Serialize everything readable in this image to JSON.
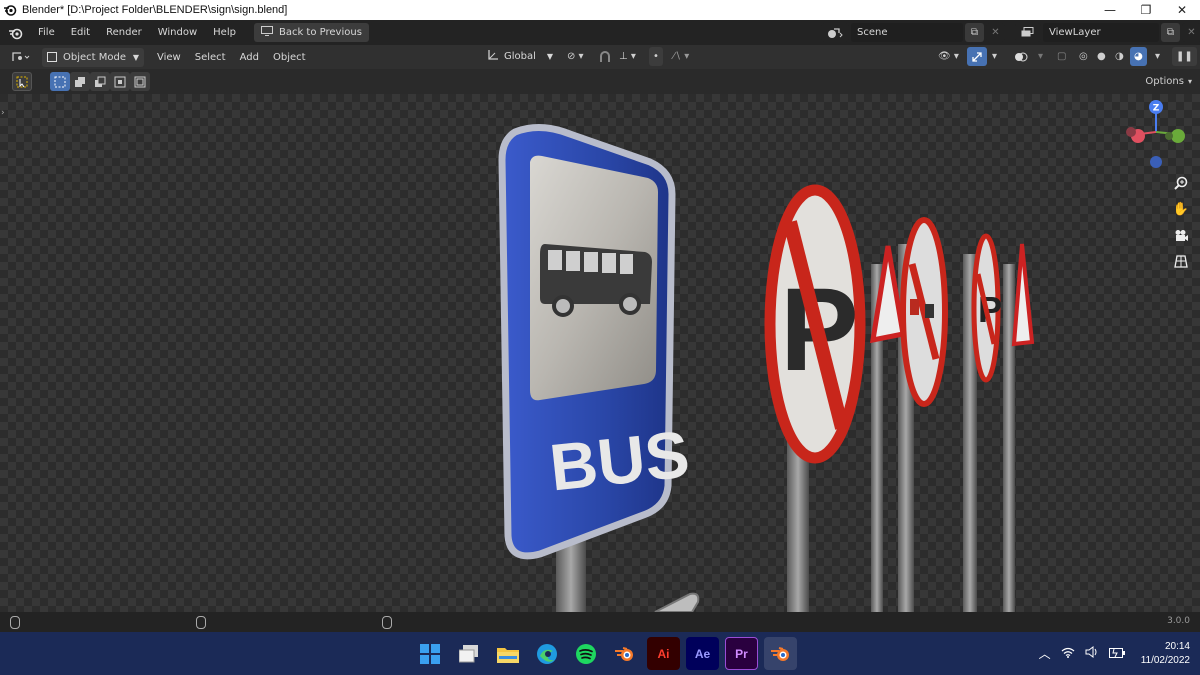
{
  "window": {
    "title": "Blender* [D:\\Project Folder\\BLENDER\\sign\\sign.blend]",
    "controls": [
      "—",
      "❐",
      "✕"
    ]
  },
  "topbar": {
    "menus": [
      "File",
      "Edit",
      "Render",
      "Window",
      "Help"
    ],
    "back_button": "Back to Previous",
    "scene_name": "Scene",
    "view_layer": "ViewLayer"
  },
  "header": {
    "mode": "Object Mode",
    "menus": [
      "View",
      "Select",
      "Add",
      "Object"
    ],
    "transform_orientation": "Global"
  },
  "toolbar": {
    "options_label": "Options"
  },
  "viewport": {
    "sign_text": "BUS",
    "gizmo_axis": "Z"
  },
  "statusbar": {
    "version": "3.0.0"
  },
  "taskbar": {
    "apps": [
      {
        "name": "windows-start",
        "label": ""
      },
      {
        "name": "file-explorer-window",
        "label": ""
      },
      {
        "name": "file-explorer",
        "label": ""
      },
      {
        "name": "edge",
        "label": ""
      },
      {
        "name": "spotify",
        "label": ""
      },
      {
        "name": "blender",
        "label": ""
      },
      {
        "name": "illustrator",
        "label": "Ai"
      },
      {
        "name": "after-effects",
        "label": "Ae"
      },
      {
        "name": "premiere",
        "label": "Pr"
      },
      {
        "name": "blender-active",
        "label": ""
      }
    ],
    "time": "20:14",
    "date": "11/02/2022"
  },
  "colors": {
    "accent": "#4772b3",
    "taskbar": "#1b2a57",
    "bus_blue": "#2a47a8",
    "sign_red": "#d22a1c"
  }
}
